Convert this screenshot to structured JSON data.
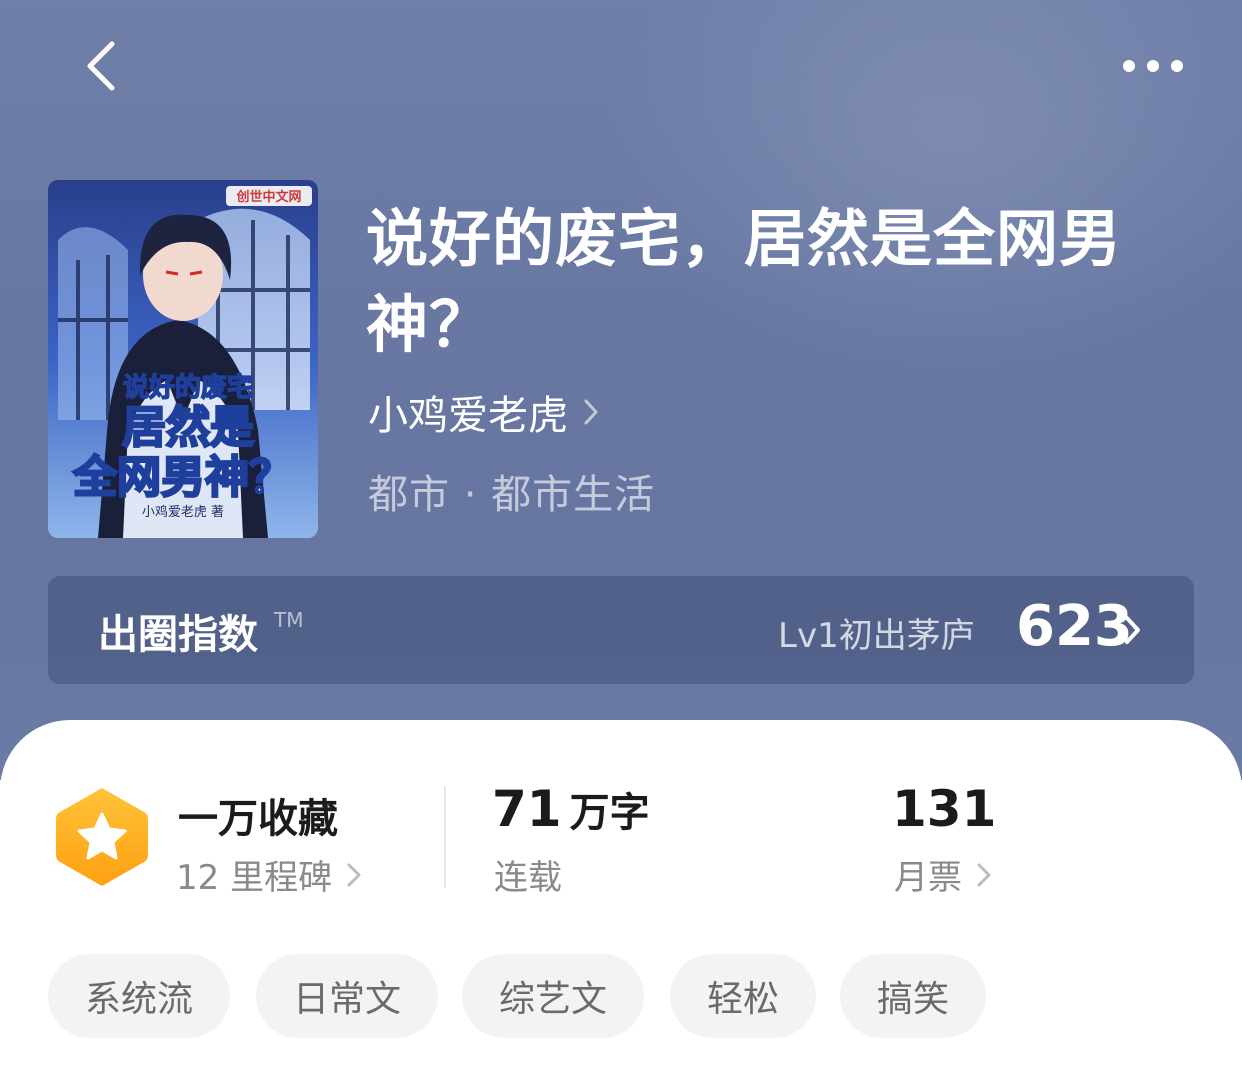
{
  "nav": {
    "back_icon": "chevron-left-icon",
    "more_icon": "more-horizontal-icon"
  },
  "book": {
    "title": "说好的废宅，居然是全网男神？",
    "author": "小鸡爱老虎",
    "genre": "都市 · 都市生活",
    "cover": {
      "publisher_logo": "创世中文网",
      "title_line1": "说好的废宅",
      "title_line2": "居然是",
      "title_line3": "全网男神？",
      "author_line": "小鸡爱老虎 著"
    }
  },
  "index": {
    "label": "出圈指数",
    "tm": "TM",
    "level": "Lv1初出茅庐",
    "score": "623"
  },
  "stats": {
    "favorites": {
      "title": "一万收藏",
      "sub": "12 里程碑"
    },
    "words": {
      "number": "71",
      "unit": "万字",
      "sub": "连载"
    },
    "tickets": {
      "number": "131",
      "sub": "月票"
    }
  },
  "tags": [
    "系统流",
    "日常文",
    "综艺文",
    "轻松",
    "搞笑"
  ],
  "colors": {
    "hero_bg": "#6a7aa4",
    "badge_orange": "#ffb21e",
    "tag_bg": "#f3f3f3"
  }
}
